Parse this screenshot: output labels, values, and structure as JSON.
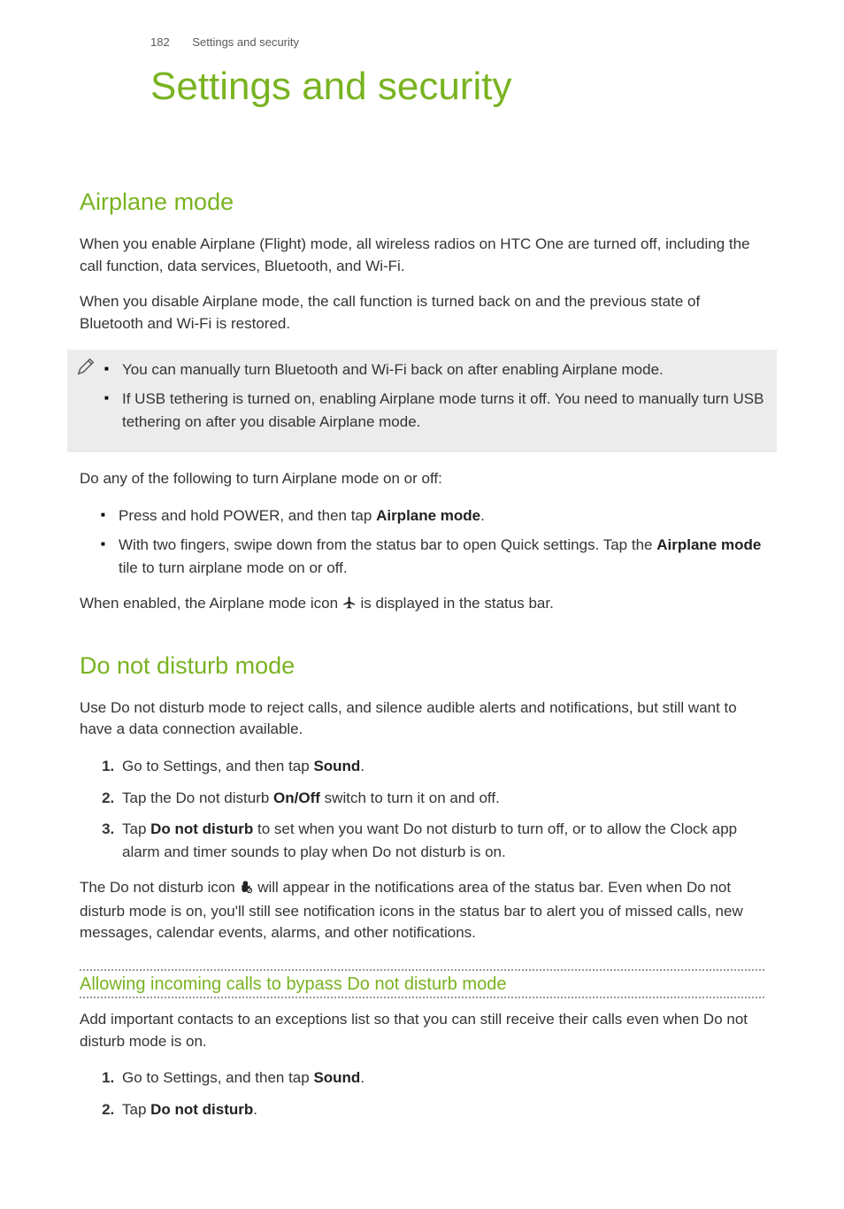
{
  "header": {
    "page_number": "182",
    "running_title": "Settings and security"
  },
  "title": "Settings and security",
  "airplane": {
    "heading": "Airplane mode",
    "p1": "When you enable Airplane (Flight) mode, all wireless radios on HTC One are turned off, including the call function, data services, Bluetooth, and Wi-Fi.",
    "p2": "When you disable Airplane mode, the call function is turned back on and the previous state of Bluetooth and Wi-Fi is restored.",
    "note1": "You can manually turn Bluetooth and Wi-Fi back on after enabling Airplane mode.",
    "note2": "If USB tethering is turned on, enabling Airplane mode turns it off. You need to manually turn USB tethering on after you disable Airplane mode.",
    "p3": "Do any of the following to turn Airplane mode on or off:",
    "b1a": "Press and hold POWER, and then tap ",
    "b1b": "Airplane mode",
    "b1c": ".",
    "b2a": "With two fingers, swipe down from the status bar to open Quick settings. Tap the ",
    "b2b": "Airplane mode",
    "b2c": " tile to turn airplane mode on or off.",
    "p4a": "When enabled, the Airplane mode icon ",
    "p4b": " is displayed in the status bar."
  },
  "dnd": {
    "heading": "Do not disturb mode",
    "p1": "Use Do not disturb mode to reject calls, and silence audible alerts and notifications, but still want to have a data connection available.",
    "s1a": "Go to Settings, and then tap ",
    "s1b": "Sound",
    "s1c": ".",
    "s2a": "Tap the Do not disturb ",
    "s2b": "On/Off",
    "s2c": " switch to turn it on and off.",
    "s3a": "Tap ",
    "s3b": "Do not disturb",
    "s3c": " to set when you want Do not disturb to turn off, or to allow the Clock app alarm and timer sounds to play when Do not disturb is on.",
    "p2a": "The Do not disturb icon ",
    "p2b": " will appear in the notifications area of the status bar. Even when Do not disturb mode is on, you'll still see notification icons in the status bar to alert you of missed calls, new messages, calendar events, alarms, and other notifications.",
    "sub": "Allowing incoming calls to bypass Do not disturb mode",
    "p3": "Add important contacts to an exceptions list so that you can still receive their calls even when Do not disturb mode is on.",
    "s4a": "Go to Settings, and then tap ",
    "s4b": "Sound",
    "s4c": ".",
    "s5a": "Tap ",
    "s5b": "Do not disturb",
    "s5c": "."
  }
}
